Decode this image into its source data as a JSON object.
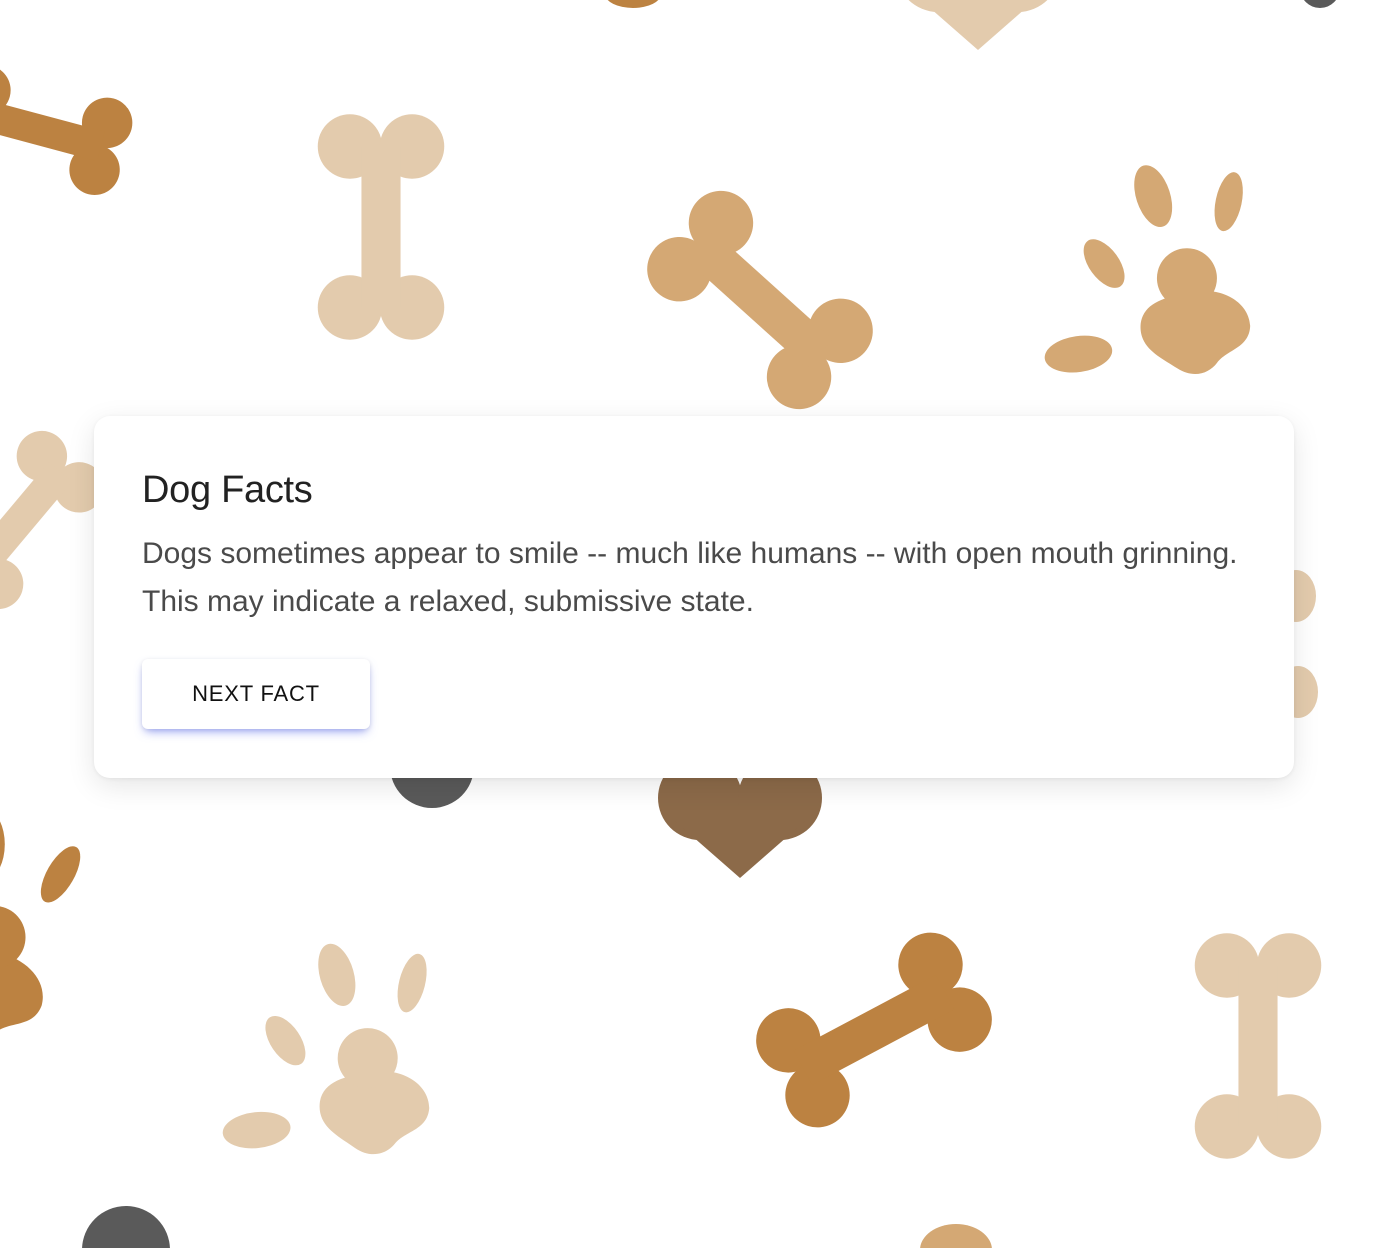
{
  "card": {
    "title": "Dog Facts",
    "fact": "Dogs sometimes appear to smile -- much like humans -- with open mouth grinning. This may indicate a relaxed, submissive state.",
    "next_button_label": "NEXT FACT"
  },
  "background": {
    "colors": {
      "light_tan": "#E3CBAD",
      "tan": "#D4A874",
      "caramel": "#BC8241",
      "brown": "#8C6A49",
      "gray": "#5A5A5A"
    },
    "motifs": [
      "bone-icon",
      "paw-print-icon",
      "heart-icon",
      "dot"
    ]
  }
}
